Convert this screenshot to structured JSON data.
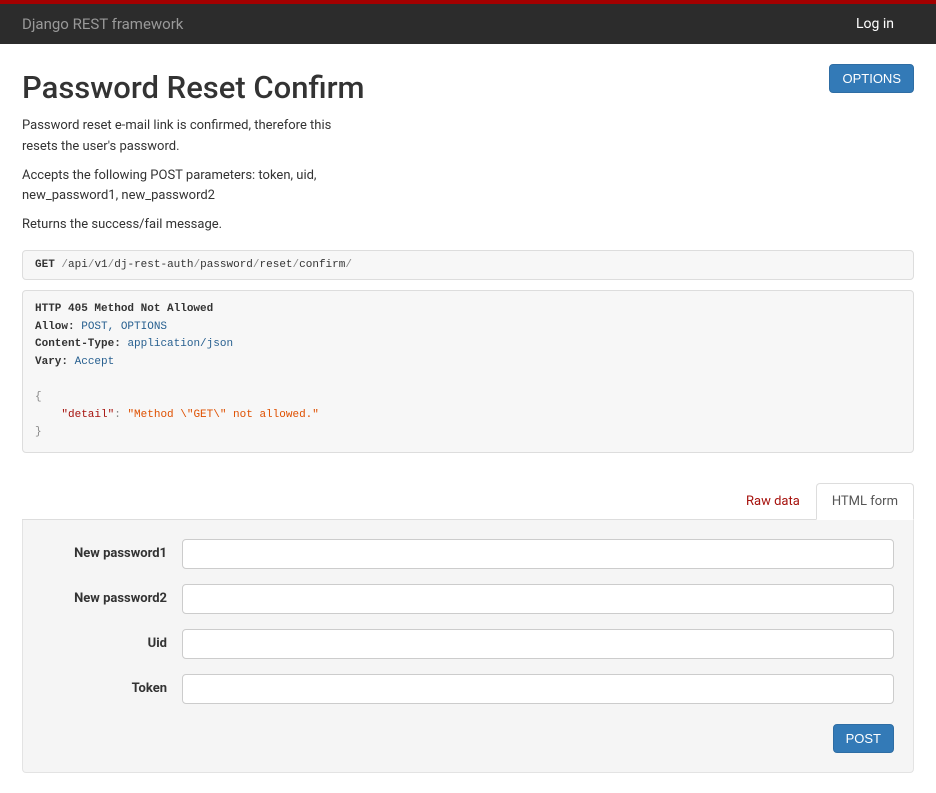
{
  "navbar": {
    "brand": "Django REST framework",
    "login": "Log in"
  },
  "page": {
    "title": "Password Reset Confirm",
    "options_btn": "OPTIONS",
    "description_line1": "Password reset e-mail link is confirmed, therefore this resets the user's password.",
    "description_line2": "Accepts the following POST parameters: token, uid, new_password1, new_password2",
    "description_line3": "Returns the success/fail message."
  },
  "request": {
    "method": "GET",
    "path_parts": [
      "api",
      "v1",
      "dj-rest-auth",
      "password",
      "reset",
      "confirm"
    ]
  },
  "response": {
    "status_line": "HTTP 405 Method Not Allowed",
    "headers": {
      "allow_key": "Allow:",
      "allow_val": "POST, OPTIONS",
      "ctype_key": "Content-Type:",
      "ctype_val": "application/json",
      "vary_key": "Vary:",
      "vary_val": "Accept"
    },
    "body_key": "\"detail\"",
    "body_val": "\"Method \\\"GET\\\" not allowed.\""
  },
  "tabs": {
    "raw": "Raw data",
    "html": "HTML form"
  },
  "form": {
    "new_password1": {
      "label": "New password1",
      "value": ""
    },
    "new_password2": {
      "label": "New password2",
      "value": ""
    },
    "uid": {
      "label": "Uid",
      "value": ""
    },
    "token": {
      "label": "Token",
      "value": ""
    },
    "submit": "POST"
  }
}
